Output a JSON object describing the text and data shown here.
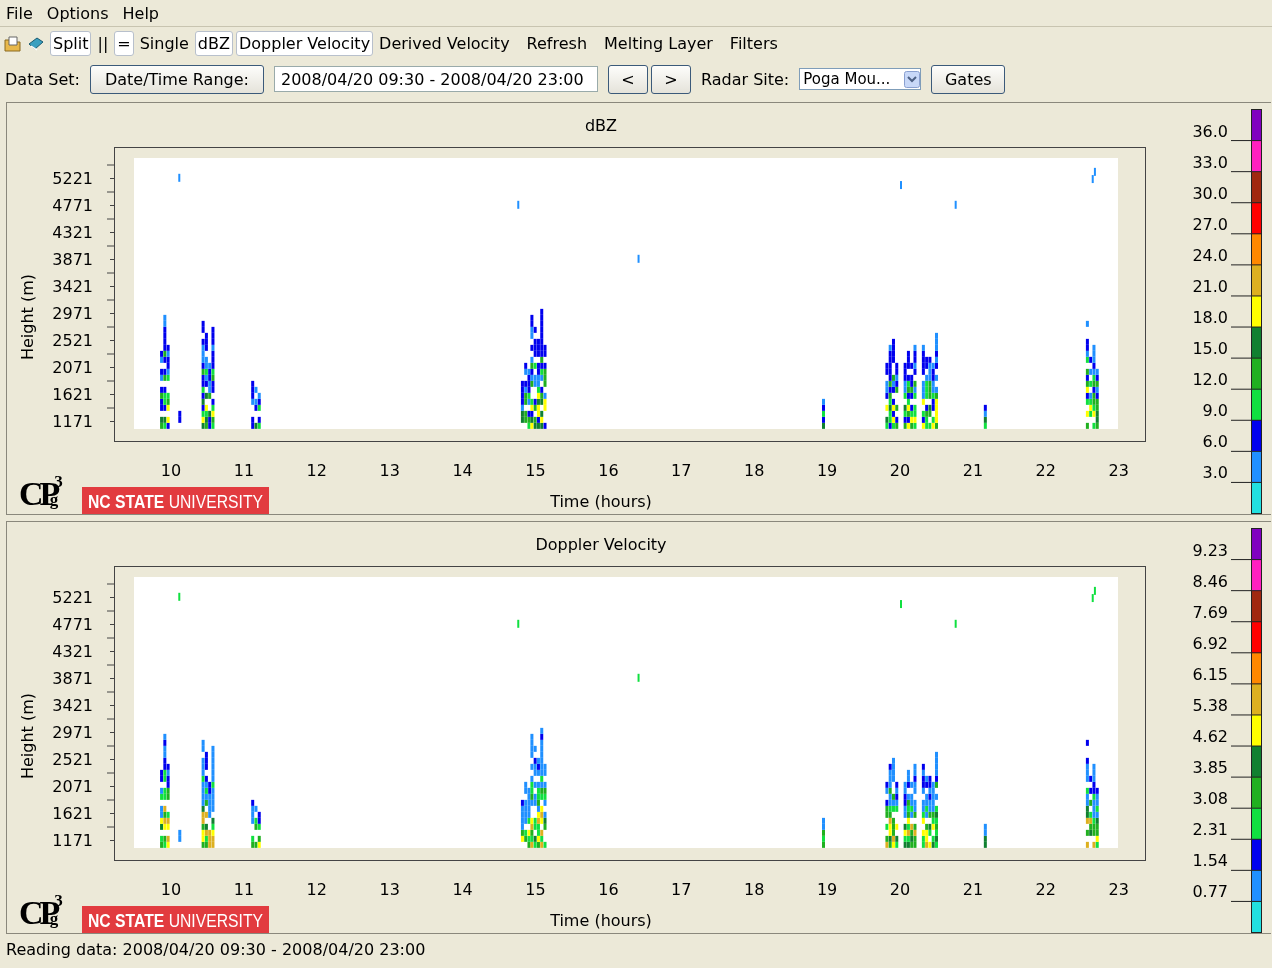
{
  "menu": [
    "File",
    "Options",
    "Help"
  ],
  "toolbar": [
    {
      "label": "Split",
      "kind": "toggle",
      "selected": true
    },
    {
      "label": "||",
      "kind": "toggle",
      "selected": false
    },
    {
      "label": "=",
      "kind": "toggle",
      "selected": true
    },
    {
      "label": "Single",
      "kind": "toggle",
      "selected": false
    },
    {
      "label": "dBZ",
      "kind": "toggle",
      "selected": true
    },
    {
      "label": "Doppler Velocity",
      "kind": "toggle",
      "selected": true
    },
    {
      "label": "Derived Velocity",
      "kind": "toggle",
      "selected": false
    },
    {
      "label": "Refresh",
      "kind": "action"
    },
    {
      "label": "Melting Layer",
      "kind": "action"
    },
    {
      "label": "Filters",
      "kind": "action"
    }
  ],
  "data_row": {
    "label": "Data Set:",
    "range_button": "Date/Time Range:",
    "range": "2008/04/20 09:30 - 2008/04/20 23:00",
    "prev": "<",
    "next": ">",
    "site_label": "Radar Site:",
    "site": "Poga Mou...",
    "gates": "Gates"
  },
  "panels": [
    {
      "title": "dBZ",
      "y_label": "Height (m)",
      "x_label": "Time (hours)",
      "y_ticks": [
        "5221",
        "4771",
        "4321",
        "3871",
        "3421",
        "2971",
        "2521",
        "2071",
        "1621",
        "1171"
      ],
      "x_ticks": [
        "10",
        "11",
        "12",
        "13",
        "14",
        "15",
        "16",
        "17",
        "18",
        "19",
        "20",
        "21",
        "22",
        "23"
      ],
      "colorbar": {
        "segments": [
          {
            "color": "#8000c0"
          },
          {
            "color": "#ff20c0"
          },
          {
            "color": "#a02810"
          },
          {
            "color": "#ff0000"
          },
          {
            "color": "#ff8800"
          },
          {
            "color": "#ddb020"
          },
          {
            "color": "#ffff00"
          },
          {
            "color": "#108030"
          },
          {
            "color": "#20b020"
          },
          {
            "color": "#10e040"
          },
          {
            "color": "#0000ee"
          },
          {
            "color": "#2090ff"
          },
          {
            "color": "#22e0e0"
          }
        ],
        "labels": [
          "36.0",
          "33.0",
          "30.0",
          "27.0",
          "24.0",
          "21.0",
          "18.0",
          "15.0",
          "12.0",
          "9.0",
          "6.0",
          "3.0"
        ]
      },
      "logo": {
        "mark": "CP",
        "sup": "3",
        "sub": "g",
        "org_bold": "NC STATE",
        "org": "UNIVERSITY"
      }
    },
    {
      "title": "Doppler Velocity",
      "y_label": "Height (m)",
      "x_label": "Time (hours)",
      "y_ticks": [
        "5221",
        "4771",
        "4321",
        "3871",
        "3421",
        "2971",
        "2521",
        "2071",
        "1621",
        "1171"
      ],
      "x_ticks": [
        "10",
        "11",
        "12",
        "13",
        "14",
        "15",
        "16",
        "17",
        "18",
        "19",
        "20",
        "21",
        "22",
        "23"
      ],
      "colorbar": {
        "segments": [
          {
            "color": "#8000c0"
          },
          {
            "color": "#ff20c0"
          },
          {
            "color": "#a02810"
          },
          {
            "color": "#ff0000"
          },
          {
            "color": "#ff8800"
          },
          {
            "color": "#ddb020"
          },
          {
            "color": "#ffff00"
          },
          {
            "color": "#108030"
          },
          {
            "color": "#20b020"
          },
          {
            "color": "#10e040"
          },
          {
            "color": "#0000ee"
          },
          {
            "color": "#2090ff"
          },
          {
            "color": "#22e0e0"
          }
        ],
        "labels": [
          "9.23",
          "8.46",
          "7.69",
          "6.92",
          "6.15",
          "5.38",
          "4.62",
          "3.85",
          "3.08",
          "2.31",
          "1.54",
          "0.77"
        ]
      },
      "logo": {
        "mark": "CP",
        "sup": "3",
        "sub": "g",
        "org_bold": "NC STATE",
        "org": "UNIVERSITY"
      }
    }
  ],
  "status_bar": "Reading data: 2008/04/20 09:30 - 2008/04/20 23:00"
}
